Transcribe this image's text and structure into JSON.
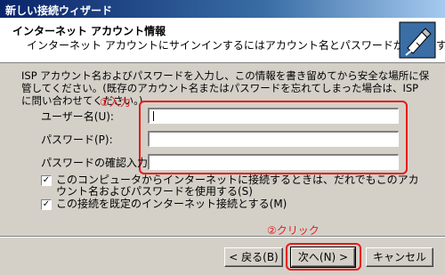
{
  "window": {
    "title": "新しい接続ウィザード"
  },
  "header": {
    "title": "インターネット アカウント情報",
    "subtitle": "インターネット アカウントにサインインするにはアカウント名とパスワードが必要です。"
  },
  "description": "ISP アカウント名およびパスワードを入力し、この情報を書き留めてから安全な場所に保管してください。(既存のアカウント名またはパスワードを忘れてしまった場合は、ISP に問い合わせてください。)",
  "annotations": {
    "step1": "①入力",
    "step2": "②クリック"
  },
  "fields": {
    "username_label": "ユーザー名(U):",
    "username_value": "",
    "password_label": "パスワード(P):",
    "password_value": "",
    "confirm_label": "パスワードの確認入力(C):",
    "confirm_value": ""
  },
  "options": {
    "share_label": "このコンピュータからインターネットに接続するときは、だれでもこのアカウント名およびパスワードを使用する(S)",
    "share_checked": true,
    "default_label": "この接続を既定のインターネット接続とする(M)",
    "default_checked": true
  },
  "buttons": {
    "back": "< 戻る(B)",
    "next": "次へ(N) >",
    "cancel": "キャンセル"
  },
  "colors": {
    "annotation": "#e81818",
    "titlebar": "#0a246a"
  }
}
